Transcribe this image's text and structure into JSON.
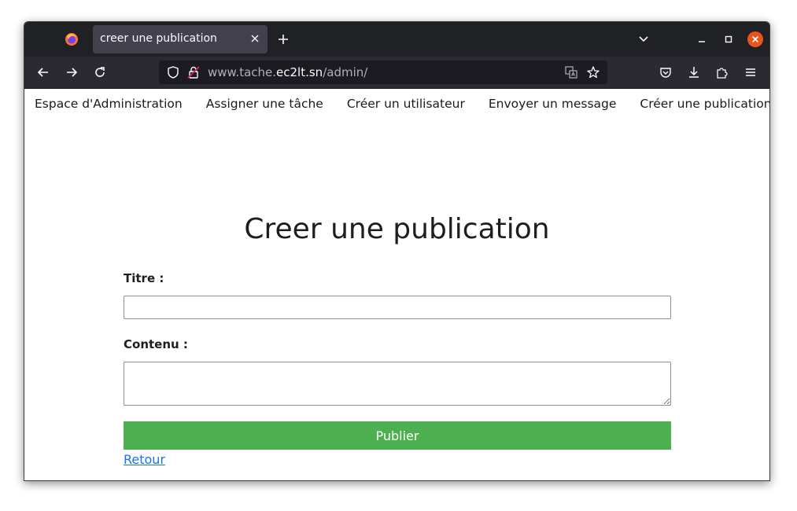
{
  "browser": {
    "tab_title": "creer une publication",
    "url_prefix": "www.tache.",
    "url_host": "ec2lt.sn",
    "url_path": "/admin/"
  },
  "nav": {
    "items": [
      "Espace d'Administration",
      "Assigner une tâche",
      "Créer un utilisateur",
      "Envoyer un message",
      "Créer une publication"
    ]
  },
  "form": {
    "heading": "Creer une publication",
    "title_label": "Titre :",
    "title_value": "",
    "content_label": "Contenu :",
    "content_value": "",
    "submit_label": "Publier",
    "back_link": "Retour"
  },
  "colors": {
    "submit_bg": "#4caf50",
    "link": "#1a73e8",
    "close_button": "#e95420"
  }
}
